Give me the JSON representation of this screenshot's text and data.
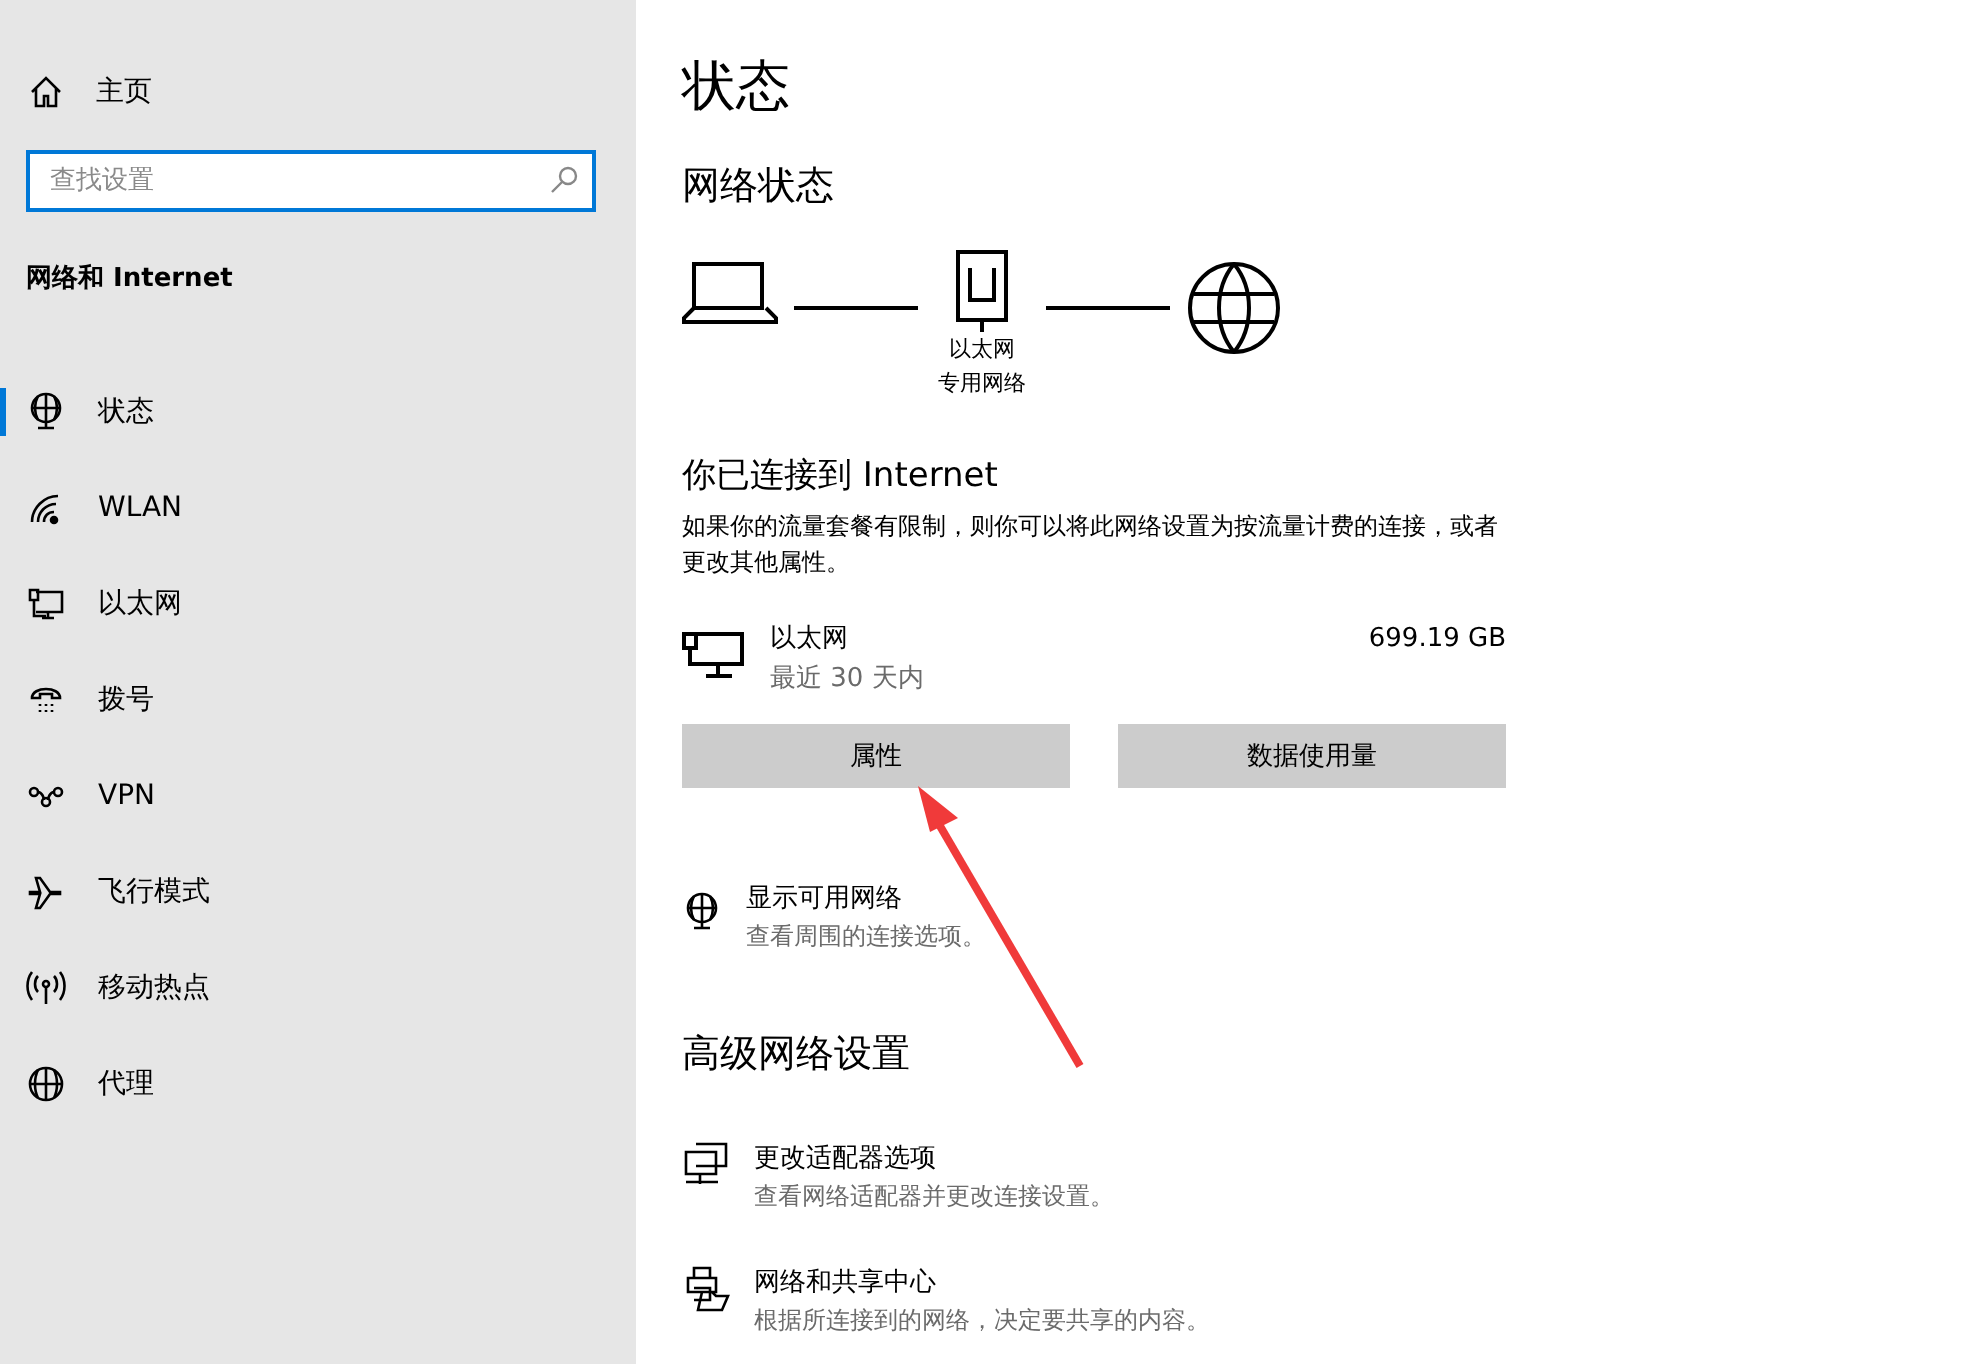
{
  "sidebar": {
    "home": "主页",
    "search": {
      "placeholder": "查找设置"
    },
    "section_title": "网络和 Internet",
    "items": [
      {
        "label": "状态",
        "selected": true
      },
      {
        "label": "WLAN",
        "selected": false
      },
      {
        "label": "以太网",
        "selected": false
      },
      {
        "label": "拨号",
        "selected": false
      },
      {
        "label": "VPN",
        "selected": false
      },
      {
        "label": "飞行模式",
        "selected": false
      },
      {
        "label": "移动热点",
        "selected": false
      },
      {
        "label": "代理",
        "selected": false
      }
    ]
  },
  "main": {
    "title": "状态",
    "network_status": {
      "heading": "网络状态",
      "adapter_label": "以太网",
      "network_type": "专用网络"
    },
    "connection": {
      "heading": "你已连接到 Internet",
      "description": "如果你的流量套餐有限制，则你可以将此网络设置为按流量计费的连接，或者更改其他属性。"
    },
    "adapter": {
      "name": "以太网",
      "period": "最近 30 天内",
      "usage": "699.19 GB"
    },
    "buttons": [
      "属性",
      "数据使用量"
    ],
    "show_networks": {
      "title": "显示可用网络",
      "subtitle": "查看周围的连接选项。"
    },
    "advanced": {
      "heading": "高级网络设置",
      "links": [
        {
          "title": "更改适配器选项",
          "subtitle": "查看网络适配器并更改连接设置。"
        },
        {
          "title": "网络和共享中心",
          "subtitle": "根据所连接到的网络，决定要共享的内容。"
        }
      ]
    }
  }
}
